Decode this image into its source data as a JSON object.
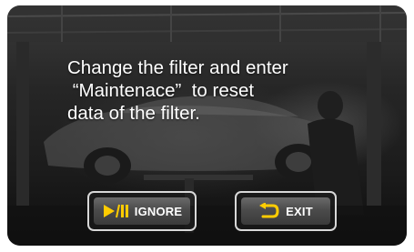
{
  "message": {
    "line1": "Change the filter and enter",
    "line2": " “Maintenace”  to reset",
    "line3": "data of the filter."
  },
  "buttons": {
    "ignore_label": "IGNORE",
    "ignore_icon": "play-pause-icon",
    "exit_label": "EXIT",
    "exit_icon": "return-arrow-icon"
  },
  "colors": {
    "accent_icon": "#ffcc00",
    "text": "#ffffff"
  }
}
